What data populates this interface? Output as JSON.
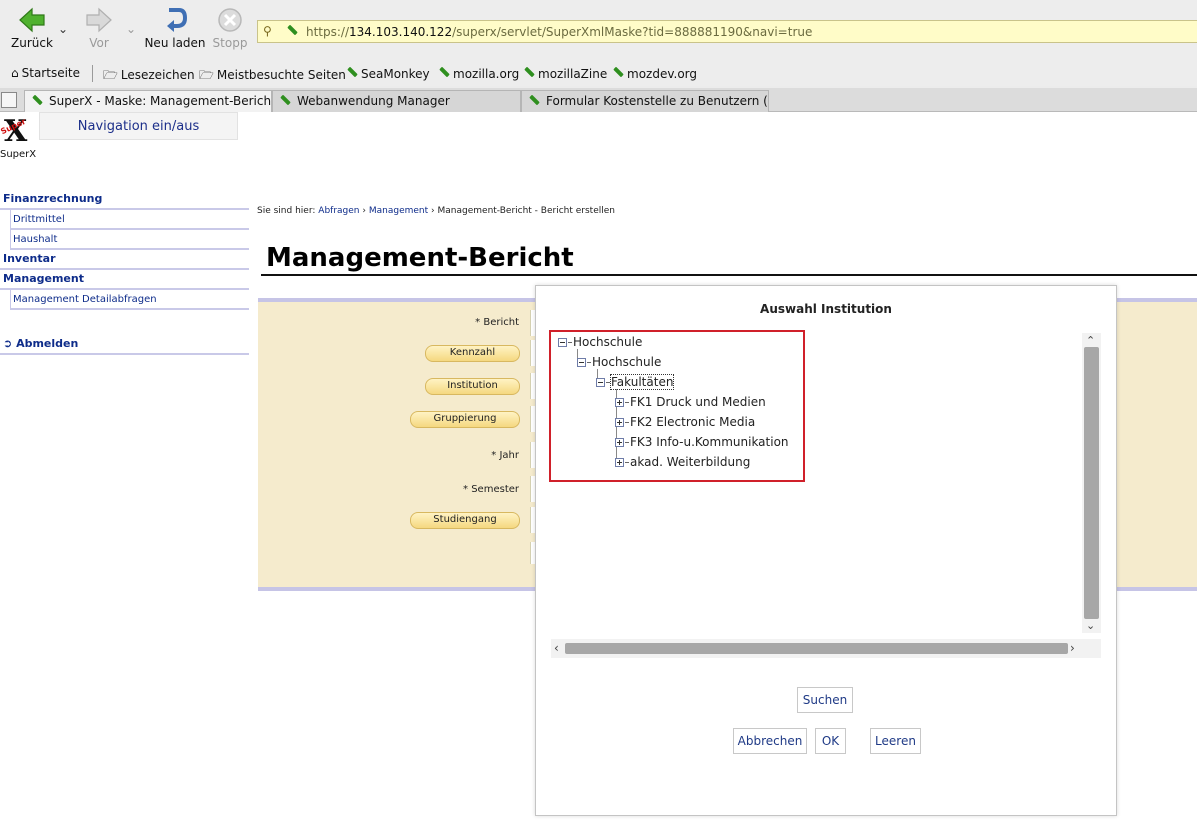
{
  "toolbar": {
    "back_label": "Zurück",
    "forward_label": "Vor",
    "reload_label": "Neu laden",
    "stop_label": "Stopp"
  },
  "urlbar": {
    "prefix": "https://",
    "host": "134.103.140.122",
    "path": "/superx/servlet/SuperXmlMaske?tid=888881190&navi=true"
  },
  "bookmarks": [
    "Startseite",
    "Lesezeichen",
    "Meistbesuchte Seiten",
    "SeaMonkey",
    "mozilla.org",
    "mozillaZine",
    "mozdev.org"
  ],
  "tabs": [
    {
      "label": "SuperX - Maske: Management-Bericht",
      "active": true
    },
    {
      "label": "Webanwendung Manager",
      "active": false
    },
    {
      "label": "Formular Kostenstelle zu Benutzern (L...",
      "active": false
    }
  ],
  "page": {
    "logo_label": "SuperX",
    "logo_mark": "X",
    "logo_small": "Super",
    "nav_toggle": "Navigation ein/aus",
    "nav": {
      "finanz": "Finanzrechnung",
      "drittmittel": "Drittmittel",
      "haushalt": "Haushalt",
      "inventar": "Inventar",
      "management": "Management",
      "detail": "Management Detailabfragen",
      "logout": "Abmelden"
    },
    "breadcrumb": {
      "prefix": "Sie sind hier:",
      "abfragen": "Abfragen",
      "management": "Management",
      "current": "Management-Bericht - Bericht erstellen"
    },
    "title": "Management-Bericht",
    "form": {
      "bericht": "* Bericht",
      "kennzahl": "Kennzahl",
      "institution": "Institution",
      "gruppierung": "Gruppierung",
      "jahr": "* Jahr",
      "semester": "* Semester",
      "studiengang": "Studiengang"
    }
  },
  "dialog": {
    "title": "Auswahl Institution",
    "tree": {
      "root": "Hochschule",
      "level1": "Hochschule",
      "level2": "Fakultäten",
      "children": [
        "FK1 Druck und Medien",
        "FK2 Electronic Media",
        "FK3 Info-u.Kommunikation",
        "akad. Weiterbildung"
      ]
    },
    "search_button": "Suchen",
    "cancel_button": "Abbrechen",
    "ok_button": "OK",
    "clear_button": "Leeren"
  }
}
